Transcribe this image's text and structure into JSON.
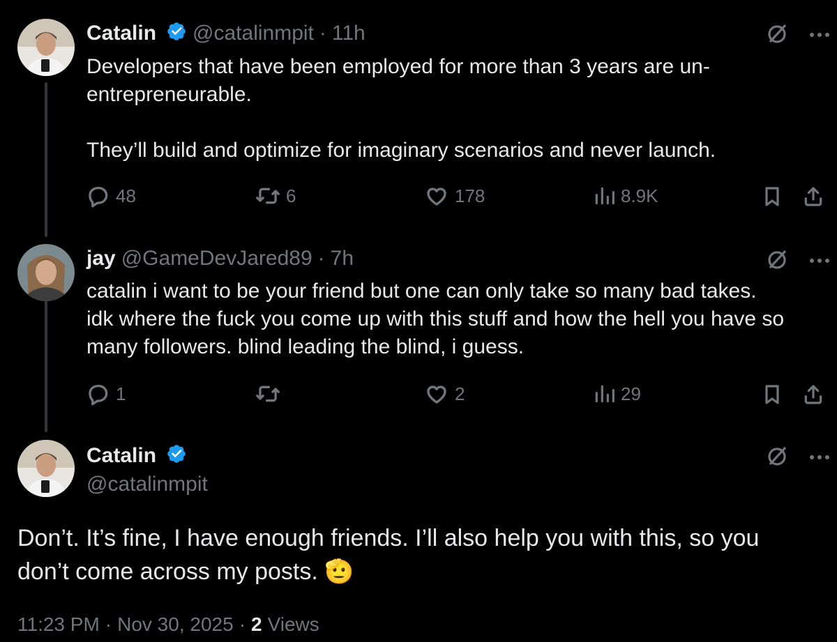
{
  "tweets": [
    {
      "author_name": "Catalin",
      "handle": "@catalinmpit",
      "separator": "·",
      "time": "11h",
      "text": "Developers that have been employed for more than 3 years are un-\nentrepreneurable.\n\nThey’ll build and optimize for imaginary scenarios and never launch.",
      "replies": "48",
      "reposts": "6",
      "likes": "178",
      "views": "8.9K"
    },
    {
      "author_name": "jay",
      "handle": "@GameDevJared89",
      "separator": "·",
      "time": "7h",
      "text": "catalin i want to be your friend but one can only take so many bad takes.\nidk where the fuck you come up with this stuff and how the hell you have so\nmany followers. blind leading the blind, i guess.",
      "replies": "1",
      "reposts": "",
      "likes": "2",
      "views": "29"
    }
  ],
  "main_tweet": {
    "author_name": "Catalin",
    "handle": "@catalinmpit",
    "text": "Don’t. It’s fine, I have enough friends. I’ll also help you with this, so you\ndon’t come across my posts.",
    "emoji": "🫡",
    "time": "11:23 PM",
    "separator1": "·",
    "date": "Nov 30, 2025",
    "separator2": "·",
    "views_count": "2",
    "views_label": "Views"
  },
  "colors": {
    "background": "#000000",
    "text": "#e7e9ea",
    "muted": "#71767b",
    "verified": "#1d9bf0",
    "thread_line": "#333639"
  },
  "icons": [
    "verified-badge-icon",
    "grok-icon",
    "more-icon",
    "reply-icon",
    "repost-icon",
    "like-icon",
    "views-icon",
    "bookmark-icon",
    "share-icon"
  ]
}
